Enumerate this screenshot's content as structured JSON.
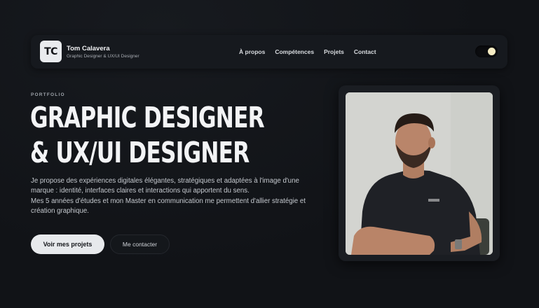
{
  "header": {
    "logo_text": "TC",
    "name": "Tom Calavera",
    "subtitle": "Graphic Designer & UX/UI Designer",
    "nav": [
      "À propos",
      "Compétences",
      "Projets",
      "Contact"
    ]
  },
  "hero": {
    "eyebrow": "PORTFOLIO",
    "title_line1": "GRAPHIC DESIGNER",
    "title_line2": "& UX/UI DESIGNER",
    "lead_line1": "Je propose des expériences digitales élégantes, stratégiques et adaptées à l'image d'une marque : identité, interfaces claires et interactions qui apportent du sens.",
    "lead_line2": "Mes 5 années d'études et mon Master en communication me permettent d'allier stratégie et création graphique.",
    "primary_cta": "Voir mes projets",
    "secondary_cta": "Me contacter"
  },
  "colors": {
    "background": "#111317",
    "header_bg": "#16191e",
    "primary_button": "#e7e9ec",
    "toggle_knob": "#f7edc4"
  },
  "icons": {
    "theme_toggle": "theme-toggle-icon"
  }
}
